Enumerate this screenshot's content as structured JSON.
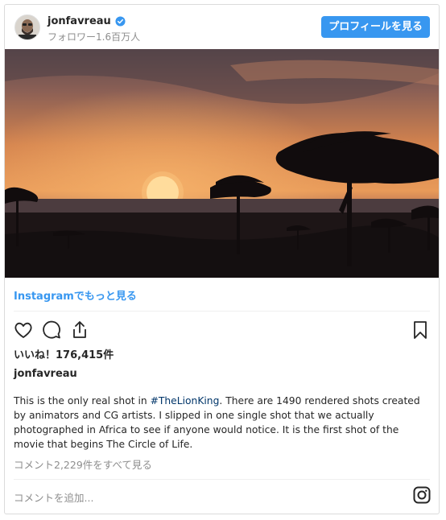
{
  "header": {
    "username": "jonfavreau",
    "followers": "フォロワー1.6百万人",
    "profile_button": "プロフィールを見る",
    "verified": true
  },
  "post": {
    "image_alt": "sunset over acacia trees",
    "more_on_instagram": "Instagramでもっと見る",
    "likes": "いいね！176,415件",
    "caption_user": "jonfavreau",
    "caption_before": "This is the only real shot in ",
    "caption_hashtag": "#TheLionKing",
    "caption_after": ". There are 1490 rendered shots created by animators and CG artists. I slipped in one single shot that we actually photographed in Africa to see if anyone would notice. It is the first shot of the movie that begins The Circle of Life.",
    "view_all_comments": "コメント2,229件をすべて見る",
    "add_comment_placeholder": "コメントを追加..."
  },
  "colors": {
    "accent": "#3897f0",
    "hashtag": "#003569",
    "muted": "#8e8e8e"
  },
  "icons": [
    "verified-icon",
    "heart-icon",
    "comment-icon",
    "share-icon",
    "bookmark-icon",
    "instagram-icon"
  ]
}
